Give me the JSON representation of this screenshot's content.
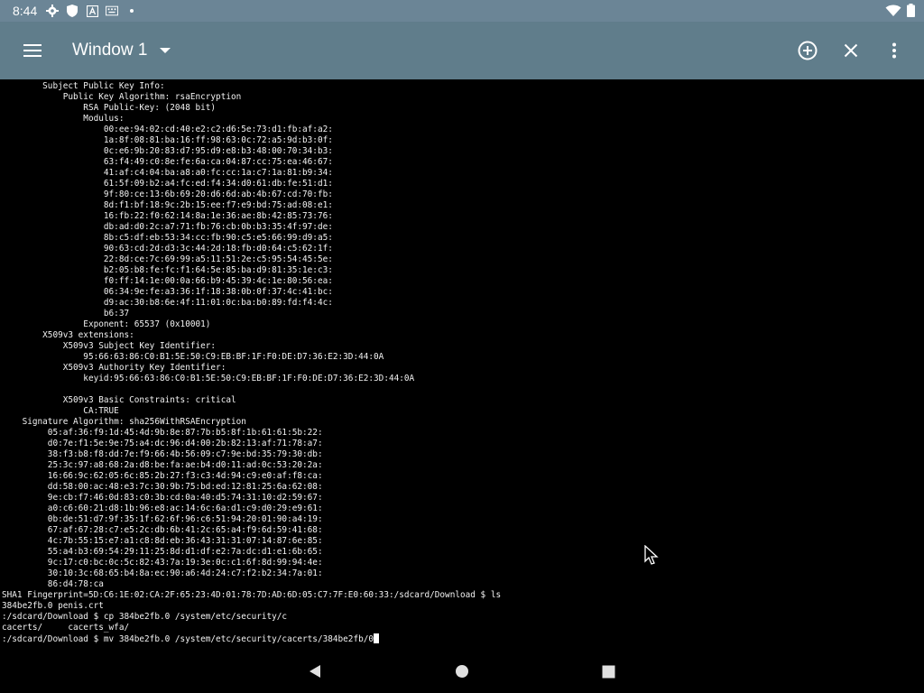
{
  "status_bar": {
    "time": "8:44",
    "icons": [
      "gear-icon",
      "shield-icon",
      "a-icon",
      "keyboard-icon",
      "dot-icon"
    ],
    "right_icons": [
      "wifi-icon",
      "battery-icon"
    ]
  },
  "app_bar": {
    "title": "Window 1",
    "color": "#607d8b"
  },
  "terminal": {
    "lines": [
      "        Subject Public Key Info:",
      "            Public Key Algorithm: rsaEncryption",
      "                RSA Public-Key: (2048 bit)",
      "                Modulus:",
      "                    00:ee:94:02:cd:40:e2:c2:d6:5e:73:d1:fb:af:a2:",
      "                    1a:8f:08:81:ba:16:ff:98:63:0c:72:a5:9d:b3:0f:",
      "                    0c:e6:9b:20:83:d7:95:d9:e8:b3:48:00:70:34:b3:",
      "                    63:f4:49:c0:8e:fe:6a:ca:04:87:cc:75:ea:46:67:",
      "                    41:af:c4:04:ba:a8:a0:fc:cc:1a:c7:1a:81:b9:34:",
      "                    61:5f:09:b2:a4:fc:ed:f4:34:d0:61:db:fe:51:d1:",
      "                    9f:80:ce:13:6b:69:20:d6:6d:ab:4b:67:cd:70:fb:",
      "                    8d:f1:bf:18:9c:2b:15:ee:f7:e9:bd:75:ad:08:e1:",
      "                    16:fb:22:f0:62:14:8a:1e:36:ae:8b:42:85:73:76:",
      "                    db:ad:d0:2c:a7:71:fb:76:cb:0b:b3:35:4f:97:de:",
      "                    8b:c5:df:eb:53:34:cc:fb:90:c5:e5:66:99:d9:a5:",
      "                    90:63:cd:2d:d3:3c:44:2d:18:fb:d0:64:c5:62:1f:",
      "                    22:8d:ce:7c:69:99:a5:11:51:2e:c5:95:54:45:5e:",
      "                    b2:05:b8:fe:fc:f1:64:5e:85:ba:d9:81:35:1e:c3:",
      "                    f0:ff:14:1e:00:0a:66:b9:45:39:4c:1e:80:56:ea:",
      "                    06:34:9e:fe:a3:36:1f:18:38:0b:0f:37:4c:41:bc:",
      "                    d9:ac:30:b8:6e:4f:11:01:0c:ba:b0:89:fd:f4:4c:",
      "                    b6:37",
      "                Exponent: 65537 (0x10001)",
      "        X509v3 extensions:",
      "            X509v3 Subject Key Identifier:",
      "                95:66:63:86:C0:B1:5E:50:C9:EB:BF:1F:F0:DE:D7:36:E2:3D:44:0A",
      "            X509v3 Authority Key Identifier:",
      "                keyid:95:66:63:86:C0:B1:5E:50:C9:EB:BF:1F:F0:DE:D7:36:E2:3D:44:0A",
      "",
      "            X509v3 Basic Constraints: critical",
      "                CA:TRUE",
      "    Signature Algorithm: sha256WithRSAEncryption",
      "         05:af:36:f9:1d:45:4d:9b:8e:87:7b:b5:8f:1b:61:61:5b:22:",
      "         d0:7e:f1:5e:9e:75:a4:dc:96:d4:00:2b:82:13:af:71:78:a7:",
      "         38:f3:b8:f8:dd:7e:f9:66:4b:56:09:c7:9e:bd:35:79:30:db:",
      "         25:3c:97:a8:68:2a:d8:be:fa:ae:b4:d0:11:ad:0c:53:20:2a:",
      "         16:66:9c:62:05:6c:85:2b:27:f3:c3:4d:94:c9:e0:af:f8:ca:",
      "         dd:58:00:ac:48:e3:7c:30:9b:75:bd:ed:12:81:25:6a:62:08:",
      "         9e:cb:f7:46:0d:83:c0:3b:cd:0a:40:d5:74:31:10:d2:59:67:",
      "         a0:c6:60:21:d8:1b:96:e8:ac:14:6c:6a:d1:c9:d0:29:e9:61:",
      "         0b:de:51:d7:9f:35:1f:62:6f:96:c6:51:94:20:01:90:a4:19:",
      "         67:af:67:28:c7:e5:2c:db:6b:41:2c:65:a4:f9:6d:59:41:68:",
      "         4c:7b:55:15:e7:a1:c8:8d:eb:36:43:31:31:07:14:87:6e:85:",
      "         55:a4:b3:69:54:29:11:25:8d:d1:df:e2:7a:dc:d1:e1:6b:65:",
      "         9c:17:c0:bc:0c:5c:82:43:7a:19:3e:0c:c1:6f:8d:99:94:4e:",
      "         30:10:3c:68:65:b4:8a:ec:90:a6:4d:24:c7:f2:b2:34:7a:01:",
      "         86:d4:78:ca",
      "SHA1 Fingerprint=5D:C6:1E:02:CA:2F:65:23:4D:01:78:7D:AD:6D:05:C7:7F:E0:60:33:/sdcard/Download $ ls",
      "384be2fb.0 penis.crt",
      ":/sdcard/Download $ cp 384be2fb.0 /system/etc/security/c",
      "cacerts/     cacerts_wfa/",
      ":/sdcard/Download $ mv 384be2fb.0 /system/etc/security/cacerts/384be2fb/0"
    ]
  },
  "nav_bar": {
    "buttons": [
      "back-icon",
      "home-icon",
      "recents-icon"
    ]
  }
}
